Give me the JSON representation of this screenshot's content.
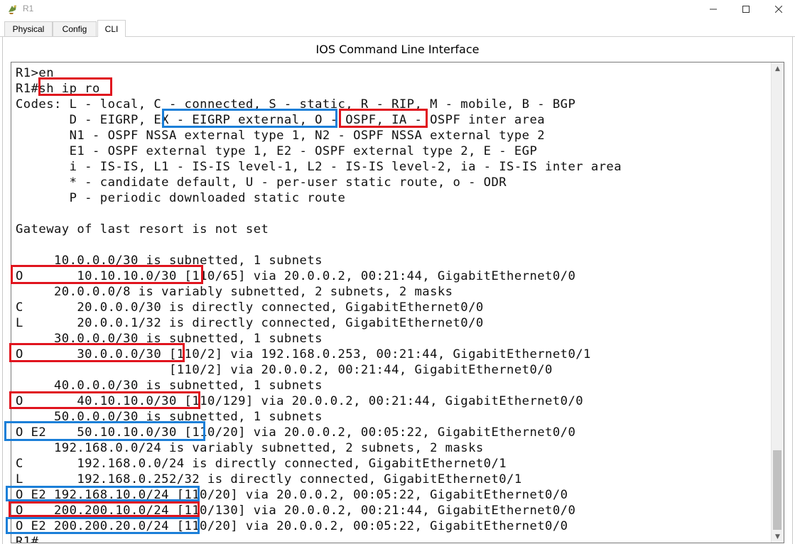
{
  "window": {
    "title": "R1",
    "icon": "router-app-icon",
    "controls": [
      "minimize",
      "maximize",
      "close"
    ]
  },
  "tabs": [
    {
      "label": "Physical",
      "active": false
    },
    {
      "label": "Config",
      "active": false
    },
    {
      "label": "CLI",
      "active": true
    }
  ],
  "panel_title": "IOS Command Line Interface",
  "terminal": {
    "lines": [
      "R1>en",
      "R1#sh ip ro",
      "Codes: L - local, C - connected, S - static, R - RIP, M - mobile, B - BGP",
      "       D - EIGRP, EX - EIGRP external, O - OSPF, IA - OSPF inter area",
      "       N1 - OSPF NSSA external type 1, N2 - OSPF NSSA external type 2",
      "       E1 - OSPF external type 1, E2 - OSPF external type 2, E - EGP",
      "       i - IS-IS, L1 - IS-IS level-1, L2 - IS-IS level-2, ia - IS-IS inter area",
      "       * - candidate default, U - per-user static route, o - ODR",
      "       P - periodic downloaded static route",
      "",
      "Gateway of last resort is not set",
      "",
      "     10.0.0.0/30 is subnetted, 1 subnets",
      "O       10.10.10.0/30 [110/65] via 20.0.0.2, 00:21:44, GigabitEthernet0/0",
      "     20.0.0.0/8 is variably subnetted, 2 subnets, 2 masks",
      "C       20.0.0.0/30 is directly connected, GigabitEthernet0/0",
      "L       20.0.0.1/32 is directly connected, GigabitEthernet0/0",
      "     30.0.0.0/30 is subnetted, 1 subnets",
      "O       30.0.0.0/30 [110/2] via 192.168.0.253, 00:21:44, GigabitEthernet0/1",
      "                    [110/2] via 20.0.0.2, 00:21:44, GigabitEthernet0/0",
      "     40.0.0.0/30 is subnetted, 1 subnets",
      "O       40.10.10.0/30 [110/129] via 20.0.0.2, 00:21:44, GigabitEthernet0/0",
      "     50.0.0.0/30 is subnetted, 1 subnets",
      "O E2    50.10.10.0/30 [110/20] via 20.0.0.2, 00:05:22, GigabitEthernet0/0",
      "     192.168.0.0/24 is variably subnetted, 2 subnets, 2 masks",
      "C       192.168.0.0/24 is directly connected, GigabitEthernet0/1",
      "L       192.168.0.252/32 is directly connected, GigabitEthernet0/1",
      "O E2 192.168.10.0/24 [110/20] via 20.0.0.2, 00:05:22, GigabitEthernet0/0",
      "O    200.200.10.0/24 [110/130] via 20.0.0.2, 00:21:44, GigabitEthernet0/0",
      "O E2 200.200.20.0/24 [110/20] via 20.0.0.2, 00:05:22, GigabitEthernet0/0",
      "R1#"
    ]
  },
  "annotations": {
    "red_color": "#e0141e",
    "blue_color": "#1b7fd8"
  }
}
